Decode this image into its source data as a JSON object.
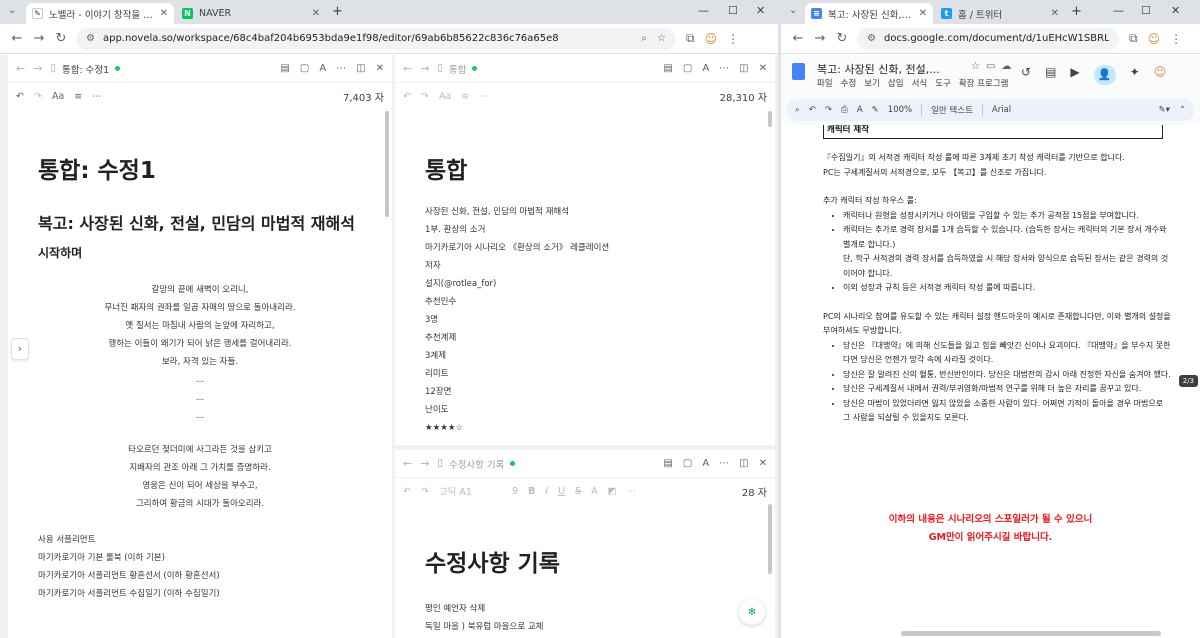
{
  "left": {
    "tabs": [
      {
        "title": "노벨라 - 이야기 창작을 위한 공간"
      },
      {
        "title": "NAVER"
      }
    ],
    "url": "app.novela.so/workspace/68c4baf204b6953bda9e1f98/editor/69ab6b85622c836c76a65e8",
    "pane1": {
      "breadcrumb": "통합: 수정1",
      "char_count": "7,403 자",
      "font_menu": "Aa",
      "title": "통합: 수정1",
      "subtitle": "복고: 사장된 신화, 전설, 민담의 마법적 재해석",
      "section": "시작하며",
      "poem1": [
        "갈망의 끝에 새벽이 오리니,",
        "무너진 패자의 권좌를 일곱 자매의 땅으로 돌아내리라.",
        "옛 질서는 마침내 사람의 눈앞에 자리하고,",
        "행하는 이들이 왜기가 되어 낡은 행세를 걸어내리라.",
        "보라, 자격 있는 자들.",
        "…",
        "…",
        "…"
      ],
      "poem2": [
        "타오르던 젖더미에 사그라든 것을 삼키고",
        "지배자의 관조 아래 그 가치를 증명하라.",
        "영웅은 신이 되어 세상을 부수고,",
        "그리하여 황금의 시대가 돌아오리라."
      ],
      "list": [
        "사용 서플리먼트",
        "마기카로기아 기본 룰북 (이하 기본)",
        "마기카로기아 서플리먼트 황혼선서 (이하 황혼선서)",
        "마기카로기아 서플리먼트 수집일기 (이하 수집일기)"
      ]
    },
    "pane2": {
      "breadcrumb": "통합",
      "char_count": "28,310 자",
      "title": "통합",
      "lines": [
        "사장된 신화, 전설, 민담의 마법적 재해석",
        "1부. 환상의 소거",
        "마기카로기아 시나리오 《환상의 소거》 레클레이션",
        "저자",
        "설지(@rotlea_for)",
        "추천인수",
        "3명",
        "추천계제",
        "3계제",
        "리미트",
        "12장면",
        "난이도",
        "★★★★☆"
      ]
    },
    "pane3": {
      "breadcrumb": "수정사항 기록",
      "font_select": "고딕 A1",
      "font_size": "9",
      "char_count": "28 자",
      "title": "수정사항 기록",
      "lines": [
        "평인 예언자 삭제",
        "독일 마을 ) 북유럽 마을으로 교체"
      ]
    }
  },
  "right": {
    "tabs": [
      {
        "title": "복고: 사장된 신화, 전설, 민담"
      },
      {
        "title": "홈 / 트위터"
      }
    ],
    "url": "docs.google.com/document/d/1uEHcW1SBRL...",
    "doc_title": "복고: 사장된 신화, 전설,...",
    "menu": [
      "파일",
      "수정",
      "보기",
      "삽입",
      "서식",
      "도구",
      "확장 프로그램"
    ],
    "toolbar": {
      "zoom": "100%",
      "style": "일반 텍스트",
      "font": "Arial"
    },
    "heading": "캐릭터 제작",
    "para1": [
      "『수집일기』의 서적경 캐릭터 작성 룰에 따른 3계제 초기 작성 캐릭터를 기반으로 합니다.",
      "PC는 구세계질서의 서적경으로, 모두 【복고】를 신조로 가집니다."
    ],
    "para2_title": "추가 캐릭터 작성 하우스 룰:",
    "bullets1": [
      "캐릭터나 원형을 성장시키거나 아이템을 구입할 수 있는 추가 공적점 15점을 부여합니다.",
      "캐릭터는 추가로 경력 장서를 1개 습득할 수 있습니다. (습득한 장서는 캐릭터의 기본 장서 개수와 별개로 합니다.)",
      "단, 학구 서적경의 경력 장서를 습득하였을 시 해당 장서와 양식으로 습득된 장서는 같은 경력의 것이어야 합니다.",
      "이외 성장과 규칙 등은 서적경 캐릭터 작성 룰에 따릅니다."
    ],
    "para3": "PC의 시나리오 참여를 유도할 수 있는 캐릭터 설정 핸드아웃이 예시로 존재합니다만, 이와 별개의 설정을 부여하셔도 무방합니다.",
    "bullets2": [
      "당신은 『대맹약』에 의해 신도들을 잃고 힘을 빼앗긴 신이나 요괴이다. 『대맹약』을 부수지 못한다면 당신은 언젠가 망각 속에 사라질 것이다.",
      "당신은 잘 알려진 신의 혈통, 반신반인이다. 당신은 대법전의 감시 아래 진정한 자신을 숨겨야 했다.",
      "당신은 구세계질서 내에서 권력/부귀영화/마법적 연구를 위해 더 높은 자리를 꿈꾸고 있다.",
      "당신은 마법이 있었더라면 잃지 않았을 소중한 사람이 있다. 어쩌면 기적이 돌아올 경우 마법으로 그 사람을 되살릴 수 있을지도 모른다."
    ],
    "warning": [
      "이하의 내용은 시나리오의 스포일러가 될 수 있으니",
      "GM만이 읽어주시길 바랍니다."
    ],
    "page_badge": "2/3"
  },
  "colors": {
    "warning": "#e8171c",
    "accent_green": "#22c55e",
    "docs_blue": "#4285f4"
  }
}
